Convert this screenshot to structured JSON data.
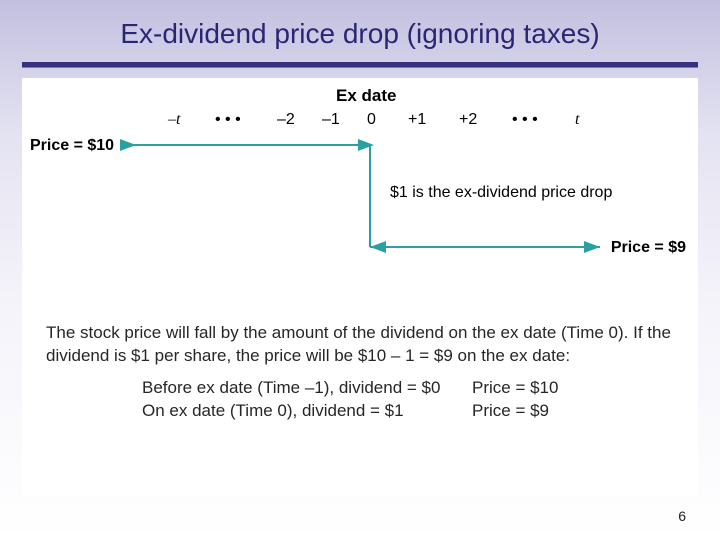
{
  "slide": {
    "title": "Ex-dividend price drop (ignoring taxes)",
    "page_number": "6"
  },
  "diagram": {
    "ex_date_label": "Ex date",
    "price_before_label": "Price = $10",
    "price_after_label": "Price = $9",
    "drop_note": "$1 is the ex-dividend price drop",
    "timeline": {
      "neg_t": "–t",
      "dots_left": "• • •",
      "neg_2": "–2",
      "neg_1": "–1",
      "zero": "0",
      "pos_1": "+1",
      "pos_2": "+2",
      "dots_right": "• • •",
      "pos_t": "t"
    }
  },
  "explanation": {
    "line1": "The stock price will fall by the amount of the dividend on the ex date (Time 0). If the dividend is $1 per share, the price will be $10 – 1 = $9 on the ex date:",
    "rows": [
      {
        "lhs": "Before ex date (Time –1), dividend = $0",
        "rhs": "Price = $10"
      },
      {
        "lhs": "On ex date (Time 0), dividend = $1",
        "rhs": "Price = $9"
      }
    ]
  }
}
